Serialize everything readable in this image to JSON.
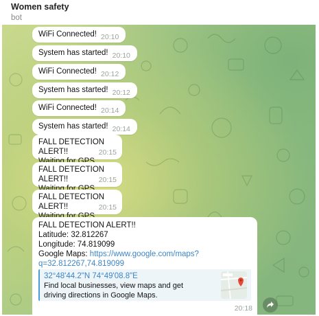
{
  "header": {
    "title": "Women safety",
    "subtitle": "bot"
  },
  "messages": [
    {
      "text": "WiFi Connected!",
      "time": "20:10"
    },
    {
      "text": "System has started!",
      "time": "20:10"
    },
    {
      "text": "WiFi Connected!",
      "time": "20:12"
    },
    {
      "text": "System has started!",
      "time": "20:12"
    },
    {
      "text": "WiFi Connected!",
      "time": "20:14"
    },
    {
      "text": "System has started!",
      "time": "20:14"
    },
    {
      "line1": "FALL DETECTION ALERT!!",
      "line2": "Waiting for GPS...",
      "time": "20:15"
    },
    {
      "line1": "FALL DETECTION ALERT!!",
      "line2": "Waiting for GPS...",
      "time": "20:15"
    },
    {
      "line1": "FALL DETECTION ALERT!!",
      "line2": "Waiting for GPS...",
      "time": "20:15"
    }
  ],
  "last_message": {
    "line1": "FALL DETECTION ALERT!!",
    "latitude": "Latitude: 32.812267",
    "longitude": "Longitude: 74.819099",
    "maps_label": "Google Maps: ",
    "link_part1": "https://www.google.com/maps?",
    "link_part2": "q=32.812267,74.819099",
    "preview_title": "32°48'44.2\"N 74°49'08.8\"E",
    "preview_desc": "Find local businesses, view maps and get driving directions in Google Maps.",
    "time": "20:18"
  },
  "icons": {
    "share": "share-arrow-icon",
    "thumbnail": "map-thumbnail",
    "pin": "map-pin-icon"
  },
  "colors": {
    "link": "#3b86c7",
    "preview_border": "#4d9bd6",
    "time": "#9aa39a"
  }
}
